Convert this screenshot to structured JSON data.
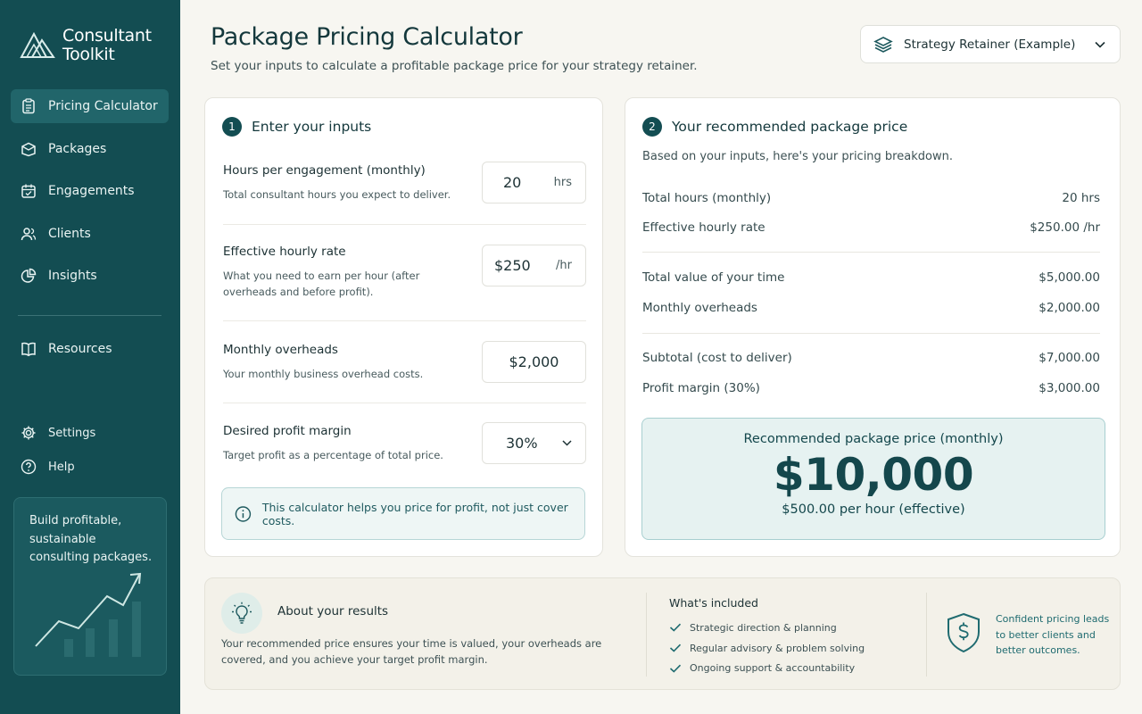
{
  "app": {
    "name_line1": "Consultant",
    "name_line2": "Toolkit"
  },
  "sidebar": {
    "items": [
      {
        "label": "Pricing Calculator",
        "icon": "clipboard-icon",
        "active": true
      },
      {
        "label": "Packages",
        "icon": "package-icon"
      },
      {
        "label": "Engagements",
        "icon": "calendar-icon"
      },
      {
        "label": "Clients",
        "icon": "users-icon"
      },
      {
        "label": "Insights",
        "icon": "pie-chart-icon"
      }
    ],
    "resources": {
      "label": "Resources",
      "icon": "book-icon"
    },
    "settings": {
      "label": "Settings",
      "icon": "gear-icon"
    },
    "help": {
      "label": "Help",
      "icon": "help-icon"
    },
    "promo": "Build profitable, sustainable consulting packages."
  },
  "header": {
    "title": "Package Pricing Calculator",
    "subtitle": "Set your inputs to calculate a profitable package price for your strategy retainer.",
    "package_select": "Strategy Retainer (Example)"
  },
  "inputs": {
    "step_number": "1",
    "title": "Enter your inputs",
    "hours": {
      "label": "Hours per engagement (monthly)",
      "help": "Total consultant hours you expect to deliver.",
      "value": "20",
      "unit": "hrs"
    },
    "rate": {
      "label": "Effective hourly rate",
      "help": "What you need to earn per hour (after overheads and before profit).",
      "value": "$250",
      "unit": "/hr"
    },
    "overheads": {
      "label": "Monthly overheads",
      "help": "Your monthly business overhead costs.",
      "value": "$2,000"
    },
    "margin": {
      "label": "Desired profit margin",
      "help": "Target profit as a percentage of total price.",
      "value": "30%"
    },
    "info": "This calculator helps you price for profit, not just cover costs."
  },
  "results": {
    "step_number": "2",
    "title": "Your recommended package price",
    "subtitle": "Based on your inputs, here's your pricing breakdown.",
    "rows": [
      {
        "label": "Total hours (monthly)",
        "value": "20 hrs"
      },
      {
        "label": "Effective hourly rate",
        "value": "$250.00 /hr"
      },
      {
        "label": "Total value of your time",
        "value": "$5,000.00"
      },
      {
        "label": "Monthly overheads",
        "value": "$2,000.00"
      },
      {
        "label": "Subtotal (cost to deliver)",
        "value": "$7,000.00"
      },
      {
        "label": "Profit margin (30%)",
        "value": "$3,000.00"
      }
    ],
    "recommended_label": "Recommended package price (monthly)",
    "recommended_price": "$10,000",
    "per_hour": "$500.00 per hour (effective)"
  },
  "about": {
    "title": "About your results",
    "text": "Your recommended price ensures your time is valued, your overheads are covered, and you achieve your target profit margin.",
    "included_title": "What's included",
    "included": [
      "Strategic direction & planning",
      "Regular advisory & problem solving",
      "Ongoing support & accountability"
    ],
    "confidence": "Confident pricing leads to better clients and better outcomes."
  },
  "colors": {
    "sidebar": "#134d52",
    "accent": "#14474c",
    "highlight_bg": "#e6f2f1"
  }
}
